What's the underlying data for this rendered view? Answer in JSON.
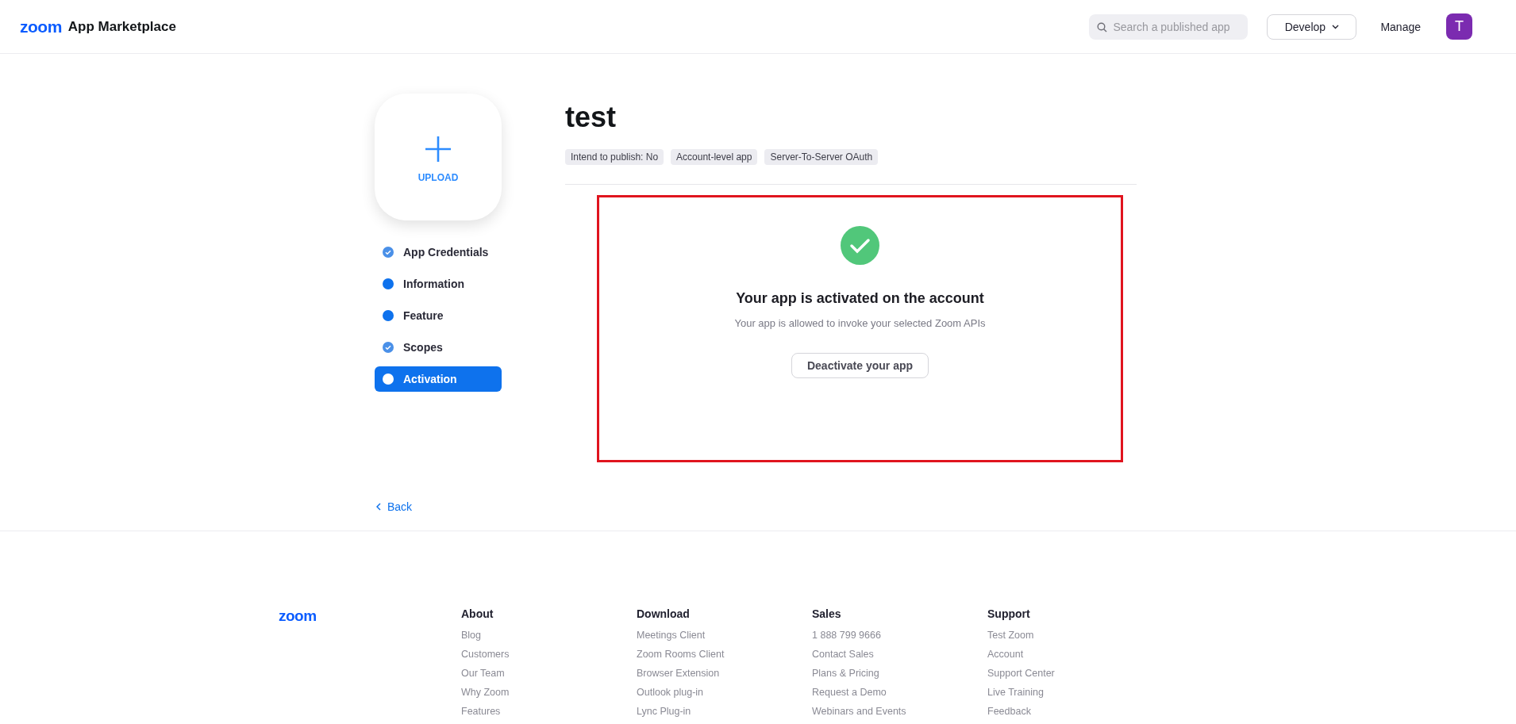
{
  "header": {
    "logo": "zoom",
    "title": "App Marketplace",
    "search": {
      "placeholder": "Search a published app"
    },
    "develop": "Develop",
    "manage": "Manage",
    "avatar": "T"
  },
  "upload": {
    "label": "UPLOAD"
  },
  "steps": [
    {
      "label": "App Credentials",
      "completed": true,
      "selected": false
    },
    {
      "label": "Information",
      "completed": false,
      "selected": false
    },
    {
      "label": "Feature",
      "completed": false,
      "selected": false
    },
    {
      "label": "Scopes",
      "completed": true,
      "selected": false
    },
    {
      "label": "Activation",
      "completed": false,
      "selected": true
    }
  ],
  "app": {
    "title": "test",
    "tags": [
      "Intend to publish: No",
      "Account-level app",
      "Server-To-Server OAuth"
    ]
  },
  "activation": {
    "heading": "Your app is activated on the account",
    "message": "Your app is allowed to invoke your selected Zoom APIs",
    "button": "Deactivate your app"
  },
  "back": "Back",
  "footer": {
    "logo": "zoom",
    "columns": [
      {
        "heading": "About",
        "links": [
          "Blog",
          "Customers",
          "Our Team",
          "Why Zoom",
          "Features"
        ]
      },
      {
        "heading": "Download",
        "links": [
          "Meetings Client",
          "Zoom Rooms Client",
          "Browser Extension",
          "Outlook plug-in",
          "Lync Plug-in"
        ]
      },
      {
        "heading": "Sales",
        "links": [
          "1 888 799 9666",
          "Contact Sales",
          "Plans & Pricing",
          "Request a Demo",
          "Webinars and Events"
        ]
      },
      {
        "heading": "Support",
        "links": [
          "Test Zoom",
          "Account",
          "Support Center",
          "Live Training",
          "Feedback"
        ]
      }
    ]
  }
}
